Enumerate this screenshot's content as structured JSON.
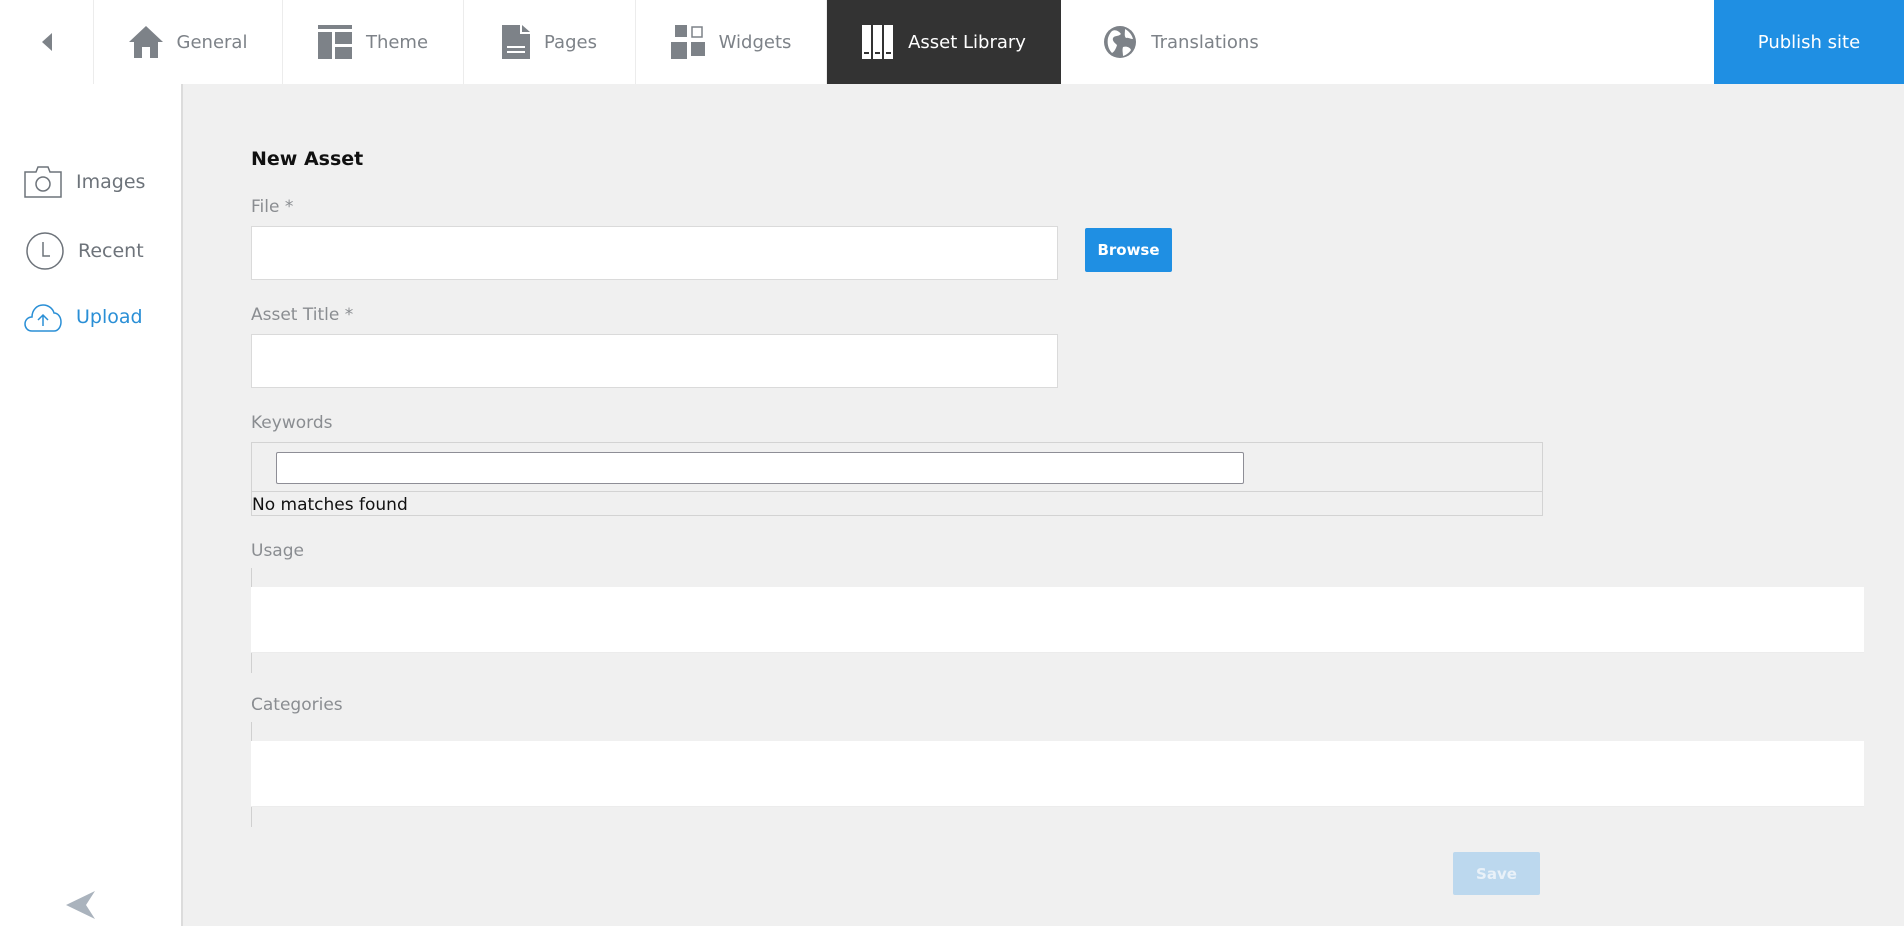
{
  "topbar": {
    "back_icon": "caret-left-icon",
    "tabs": [
      {
        "label": "General",
        "icon": "home-icon",
        "active": false
      },
      {
        "label": "Theme",
        "icon": "layout-icon",
        "active": false
      },
      {
        "label": "Pages",
        "icon": "document-icon",
        "active": false
      },
      {
        "label": "Widgets",
        "icon": "widgets-icon",
        "active": false
      },
      {
        "label": "Asset Library",
        "icon": "books-icon",
        "active": true
      },
      {
        "label": "Translations",
        "icon": "globe-icon",
        "active": false
      }
    ],
    "publish_label": "Publish site"
  },
  "sidebar": {
    "items": [
      {
        "label": "Images",
        "icon": "camera-icon",
        "active": false
      },
      {
        "label": "Recent",
        "icon": "clock-icon",
        "active": false
      },
      {
        "label": "Upload",
        "icon": "cloud-upload-icon",
        "active": true
      }
    ],
    "collapse_icon": "arrow-left-icon"
  },
  "form": {
    "title": "New Asset",
    "file_label": "File *",
    "file_value": "",
    "browse_label": "Browse",
    "asset_title_label": "Asset Title *",
    "asset_title_value": "",
    "keywords_label": "Keywords",
    "keywords_value": "",
    "keywords_message": "No matches found",
    "usage_label": "Usage",
    "categories_label": "Categories",
    "save_label": "Save"
  },
  "colors": {
    "accent": "#1f8fe3",
    "active_tab_bg": "#333333",
    "save_disabled": "#bcd8ee",
    "sidebar_active": "#2a8fd6"
  }
}
